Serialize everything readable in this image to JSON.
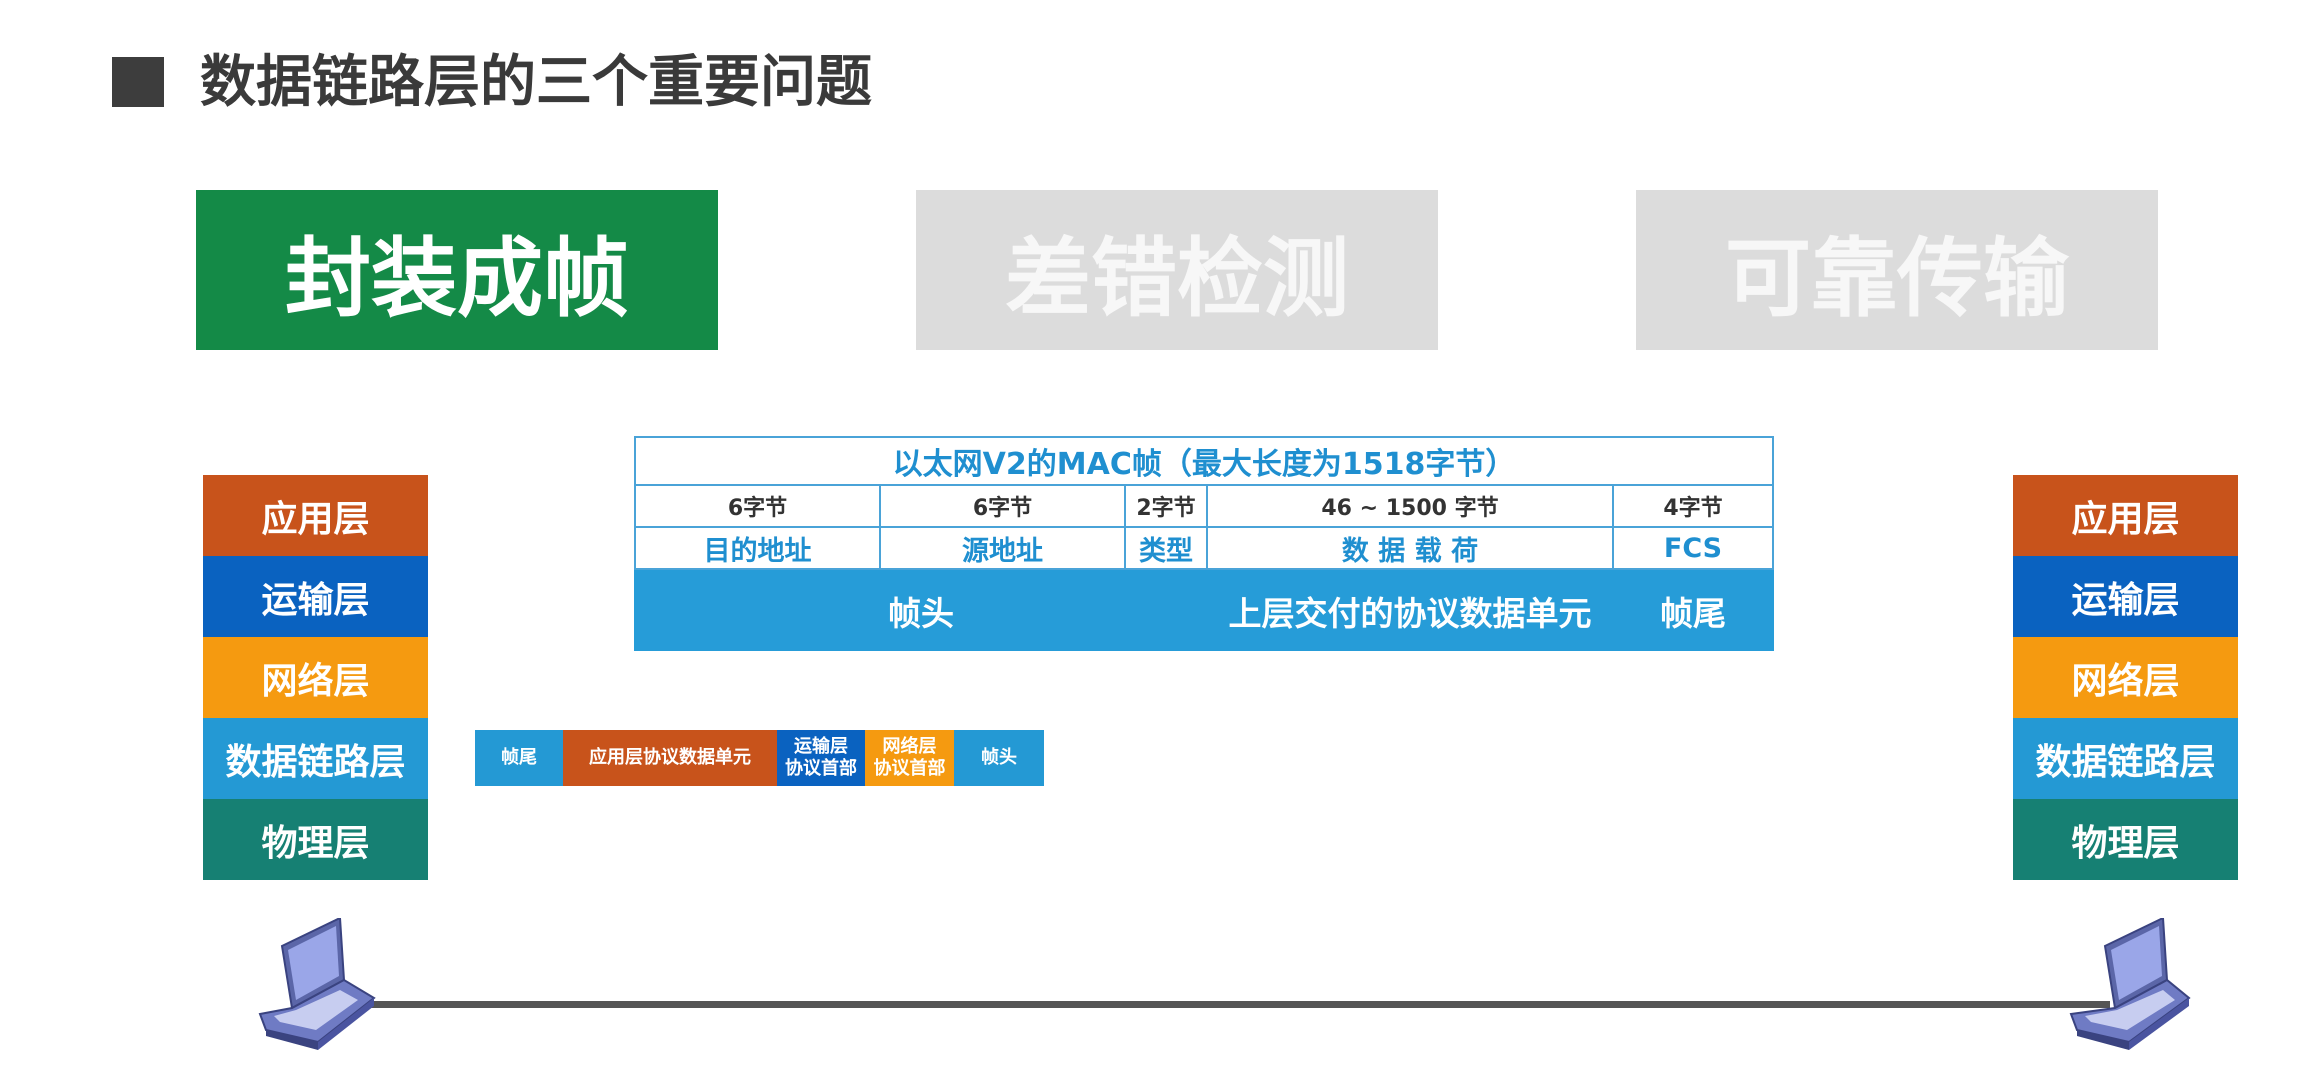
{
  "title": "数据链路层的三个重要问题",
  "tabs": [
    {
      "label": "封装成帧",
      "active": true
    },
    {
      "label": "差错检测",
      "active": false
    },
    {
      "label": "可靠传输",
      "active": false
    }
  ],
  "layers": [
    "应用层",
    "运输层",
    "网络层",
    "数据链路层",
    "物理层"
  ],
  "frame_table": {
    "title": "以太网V2的MAC帧（最大长度为1518字节）",
    "sizes": [
      "6字节",
      "6字节",
      "2字节",
      "46 ~ 1500 字节",
      "4字节"
    ],
    "fields": [
      "目的地址",
      "源地址",
      "类型",
      "数 据 载 荷",
      "FCS"
    ],
    "bar": {
      "header": "帧头",
      "payload": "上层交付的协议数据单元",
      "trailer": "帧尾"
    }
  },
  "small_frame": {
    "trailer": "帧尾",
    "app_pdu": "应用层协议数据单元",
    "transport_header": [
      "运输层",
      "协议首部"
    ],
    "network_header": [
      "网络层",
      "协议首部"
    ],
    "header": "帧头"
  },
  "colors": {
    "title_square": "#3d3d3d",
    "active_tab": "#148a47",
    "inactive_tab": "#dcdcdc",
    "application": "#c8531b",
    "transport": "#0a62c0",
    "network": "#f59a10",
    "datalink": "#2499d4",
    "physical": "#168073",
    "frame_accent": "#1f8fd0"
  },
  "icons": [
    "laptop-icon",
    "laptop-icon"
  ]
}
